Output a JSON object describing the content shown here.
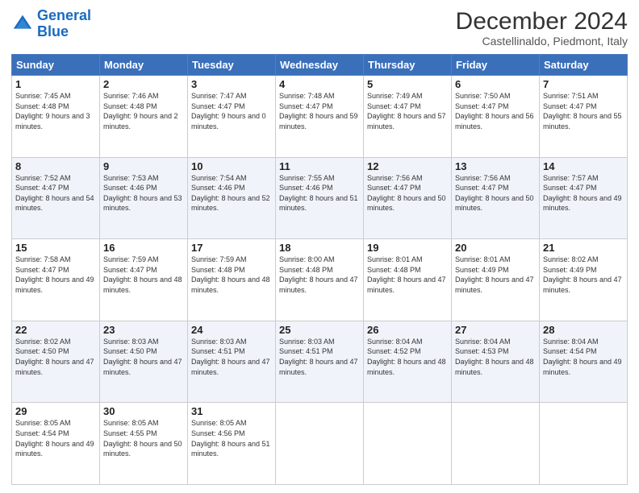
{
  "logo": {
    "name_part1": "General",
    "name_part2": "Blue"
  },
  "header": {
    "title": "December 2024",
    "subtitle": "Castellinaldo, Piedmont, Italy"
  },
  "columns": [
    "Sunday",
    "Monday",
    "Tuesday",
    "Wednesday",
    "Thursday",
    "Friday",
    "Saturday"
  ],
  "weeks": [
    [
      {
        "day": "1",
        "sunrise": "7:45 AM",
        "sunset": "4:48 PM",
        "daylight": "9 hours and 3 minutes."
      },
      {
        "day": "2",
        "sunrise": "7:46 AM",
        "sunset": "4:48 PM",
        "daylight": "9 hours and 2 minutes."
      },
      {
        "day": "3",
        "sunrise": "7:47 AM",
        "sunset": "4:47 PM",
        "daylight": "9 hours and 0 minutes."
      },
      {
        "day": "4",
        "sunrise": "7:48 AM",
        "sunset": "4:47 PM",
        "daylight": "8 hours and 59 minutes."
      },
      {
        "day": "5",
        "sunrise": "7:49 AM",
        "sunset": "4:47 PM",
        "daylight": "8 hours and 57 minutes."
      },
      {
        "day": "6",
        "sunrise": "7:50 AM",
        "sunset": "4:47 PM",
        "daylight": "8 hours and 56 minutes."
      },
      {
        "day": "7",
        "sunrise": "7:51 AM",
        "sunset": "4:47 PM",
        "daylight": "8 hours and 55 minutes."
      }
    ],
    [
      {
        "day": "8",
        "sunrise": "7:52 AM",
        "sunset": "4:47 PM",
        "daylight": "8 hours and 54 minutes."
      },
      {
        "day": "9",
        "sunrise": "7:53 AM",
        "sunset": "4:46 PM",
        "daylight": "8 hours and 53 minutes."
      },
      {
        "day": "10",
        "sunrise": "7:54 AM",
        "sunset": "4:46 PM",
        "daylight": "8 hours and 52 minutes."
      },
      {
        "day": "11",
        "sunrise": "7:55 AM",
        "sunset": "4:46 PM",
        "daylight": "8 hours and 51 minutes."
      },
      {
        "day": "12",
        "sunrise": "7:56 AM",
        "sunset": "4:47 PM",
        "daylight": "8 hours and 50 minutes."
      },
      {
        "day": "13",
        "sunrise": "7:56 AM",
        "sunset": "4:47 PM",
        "daylight": "8 hours and 50 minutes."
      },
      {
        "day": "14",
        "sunrise": "7:57 AM",
        "sunset": "4:47 PM",
        "daylight": "8 hours and 49 minutes."
      }
    ],
    [
      {
        "day": "15",
        "sunrise": "7:58 AM",
        "sunset": "4:47 PM",
        "daylight": "8 hours and 49 minutes."
      },
      {
        "day": "16",
        "sunrise": "7:59 AM",
        "sunset": "4:47 PM",
        "daylight": "8 hours and 48 minutes."
      },
      {
        "day": "17",
        "sunrise": "7:59 AM",
        "sunset": "4:48 PM",
        "daylight": "8 hours and 48 minutes."
      },
      {
        "day": "18",
        "sunrise": "8:00 AM",
        "sunset": "4:48 PM",
        "daylight": "8 hours and 47 minutes."
      },
      {
        "day": "19",
        "sunrise": "8:01 AM",
        "sunset": "4:48 PM",
        "daylight": "8 hours and 47 minutes."
      },
      {
        "day": "20",
        "sunrise": "8:01 AM",
        "sunset": "4:49 PM",
        "daylight": "8 hours and 47 minutes."
      },
      {
        "day": "21",
        "sunrise": "8:02 AM",
        "sunset": "4:49 PM",
        "daylight": "8 hours and 47 minutes."
      }
    ],
    [
      {
        "day": "22",
        "sunrise": "8:02 AM",
        "sunset": "4:50 PM",
        "daylight": "8 hours and 47 minutes."
      },
      {
        "day": "23",
        "sunrise": "8:03 AM",
        "sunset": "4:50 PM",
        "daylight": "8 hours and 47 minutes."
      },
      {
        "day": "24",
        "sunrise": "8:03 AM",
        "sunset": "4:51 PM",
        "daylight": "8 hours and 47 minutes."
      },
      {
        "day": "25",
        "sunrise": "8:03 AM",
        "sunset": "4:51 PM",
        "daylight": "8 hours and 47 minutes."
      },
      {
        "day": "26",
        "sunrise": "8:04 AM",
        "sunset": "4:52 PM",
        "daylight": "8 hours and 48 minutes."
      },
      {
        "day": "27",
        "sunrise": "8:04 AM",
        "sunset": "4:53 PM",
        "daylight": "8 hours and 48 minutes."
      },
      {
        "day": "28",
        "sunrise": "8:04 AM",
        "sunset": "4:54 PM",
        "daylight": "8 hours and 49 minutes."
      }
    ],
    [
      {
        "day": "29",
        "sunrise": "8:05 AM",
        "sunset": "4:54 PM",
        "daylight": "8 hours and 49 minutes."
      },
      {
        "day": "30",
        "sunrise": "8:05 AM",
        "sunset": "4:55 PM",
        "daylight": "8 hours and 50 minutes."
      },
      {
        "day": "31",
        "sunrise": "8:05 AM",
        "sunset": "4:56 PM",
        "daylight": "8 hours and 51 minutes."
      },
      null,
      null,
      null,
      null
    ]
  ]
}
